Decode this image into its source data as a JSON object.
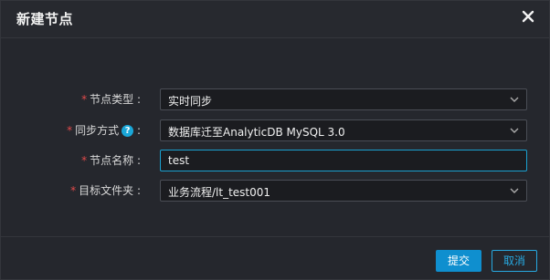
{
  "dialog": {
    "title": "新建节点",
    "close_icon": "close-icon"
  },
  "form": {
    "fields": [
      {
        "label": "节点类型",
        "required": true,
        "value": "实时同步",
        "type": "select"
      },
      {
        "label": "同步方式",
        "required": true,
        "value": "数据库迁至AnalyticDB MySQL 3.0",
        "type": "select",
        "help_icon": "question-circle-icon"
      },
      {
        "label": "节点名称",
        "required": true,
        "value": "test",
        "type": "text"
      },
      {
        "label": "目标文件夹",
        "required": true,
        "value": "业务流程/lt_test001",
        "type": "select"
      }
    ],
    "required_mark": "*",
    "label_suffix": ":"
  },
  "footer": {
    "submit_label": "提交",
    "cancel_label": "取消"
  },
  "colors": {
    "accent": "#0f8fcf",
    "required": "#e24b4b",
    "background": "#25272d"
  }
}
